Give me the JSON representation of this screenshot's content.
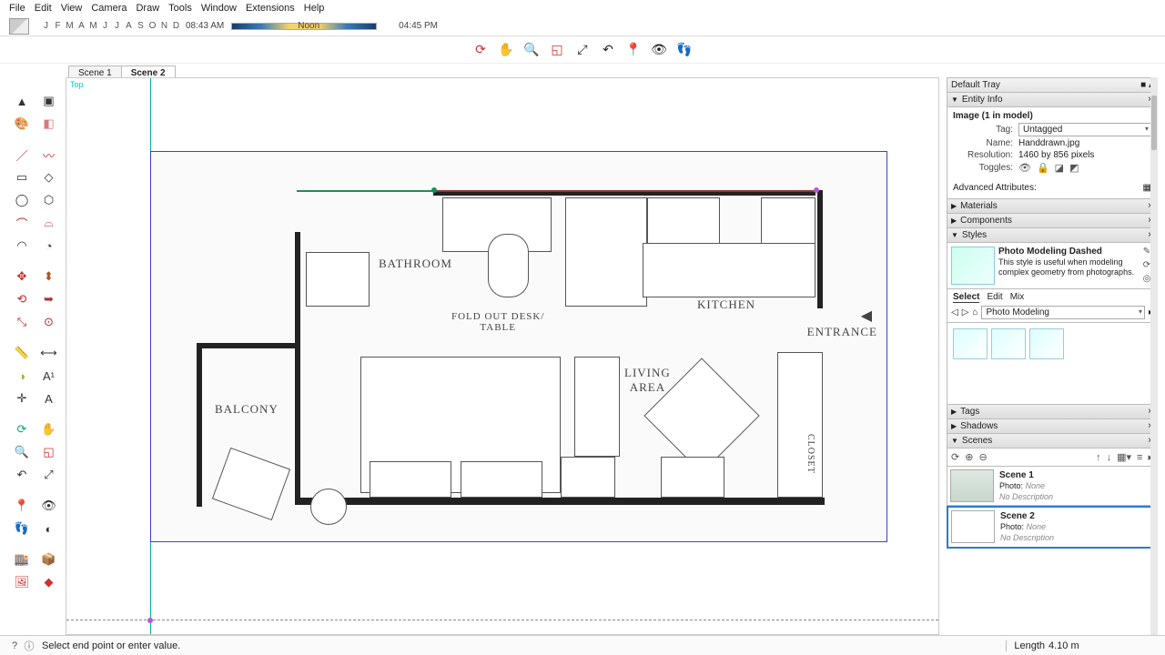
{
  "menu": {
    "items": [
      "File",
      "Edit",
      "View",
      "Camera",
      "Draw",
      "Tools",
      "Window",
      "Extensions",
      "Help"
    ]
  },
  "timebar": {
    "months": [
      "J",
      "F",
      "M",
      "A",
      "M",
      "J",
      "J",
      "A",
      "S",
      "O",
      "N",
      "D"
    ],
    "start": "08:43 AM",
    "noon": "Noon",
    "end": "04:45 PM"
  },
  "scenetabs": {
    "tabs": [
      "Scene 1",
      "Scene 2"
    ],
    "active": 1
  },
  "viewport": {
    "view_label": "Top",
    "labels": {
      "bathroom": "BATHROOM",
      "fold": "FOLD OUT DESK/\nTABLE",
      "kitchen": "KITCHEN",
      "living": "LIVING\nAREA",
      "balcony": "BALCONY",
      "entrance": "ENTRANCE",
      "closet": "CLOSET"
    }
  },
  "tray": {
    "title": "Default Tray",
    "entity": {
      "title": "Entity Info",
      "heading": "Image (1 in model)",
      "tag_label": "Tag:",
      "tag_value": "Untagged",
      "name_label": "Name:",
      "name_value": "Handdrawn.jpg",
      "res_label": "Resolution:",
      "res_value": "1460 by 856 pixels",
      "toggles_label": "Toggles:",
      "adv": "Advanced Attributes:"
    },
    "panels": {
      "materials": "Materials",
      "components": "Components",
      "styles": "Styles",
      "tags": "Tags",
      "shadows": "Shadows",
      "scenes": "Scenes"
    },
    "styles": {
      "name": "Photo Modeling Dashed",
      "desc": "This style is useful when modeling complex geometry from photographs.",
      "tabs": [
        "Select",
        "Edit",
        "Mix"
      ],
      "collection": "Photo Modeling"
    },
    "scenes": {
      "items": [
        {
          "name": "Scene 1",
          "photo_label": "Photo:",
          "photo": "None",
          "desc": "No Description"
        },
        {
          "name": "Scene 2",
          "photo_label": "Photo:",
          "photo": "None",
          "desc": "No Description"
        }
      ]
    }
  },
  "status": {
    "hint": "Select end point or enter value.",
    "measure_label": "Length",
    "measure_value": "4.10 m"
  }
}
